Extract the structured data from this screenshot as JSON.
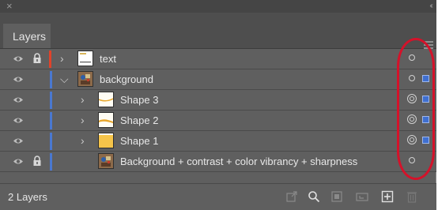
{
  "titlebar": {
    "close_glyph": "×",
    "collapse_glyph": "‹‹"
  },
  "panel": {
    "tab_label": "Layers"
  },
  "layers": [
    {
      "name": "text",
      "visible": true,
      "locked": true,
      "color": "#e0432a",
      "expandable": true,
      "expanded": false,
      "indent": 0,
      "thumb": "text-thumb",
      "target": "single",
      "selected": false
    },
    {
      "name": "background",
      "visible": true,
      "locked": false,
      "color": "#4a78d0",
      "expandable": true,
      "expanded": true,
      "indent": 0,
      "thumb": "photo-thumb",
      "target": "single",
      "selected": true
    },
    {
      "name": "Shape 3",
      "visible": true,
      "locked": false,
      "color": "#4a78d0",
      "expandable": true,
      "expanded": false,
      "indent": 1,
      "thumb": "shape-thumb",
      "target": "double",
      "selected": true
    },
    {
      "name": "Shape 2",
      "visible": true,
      "locked": false,
      "color": "#4a78d0",
      "expandable": true,
      "expanded": false,
      "indent": 1,
      "thumb": "shape-thumb",
      "target": "double",
      "selected": true
    },
    {
      "name": "Shape 1",
      "visible": true,
      "locked": false,
      "color": "#4a78d0",
      "expandable": true,
      "expanded": false,
      "indent": 1,
      "thumb": "shape-thumb",
      "target": "double",
      "selected": true
    },
    {
      "name": "Background + contrast + color vibrancy + sharpness",
      "visible": true,
      "locked": true,
      "color": "#4a78d0",
      "expandable": false,
      "expanded": false,
      "indent": 1,
      "thumb": "photo-thumb",
      "target": "single",
      "selected": false
    }
  ],
  "footer": {
    "count_label": "2 Layers",
    "icons": [
      "export-icon",
      "search-icon",
      "clipping-mask-icon",
      "sublayer-icon",
      "new-layer-icon",
      "trash-icon"
    ]
  },
  "colors": {
    "panel_bg": "#5f5f5f",
    "annotation_red": "#d4122a",
    "selection_blue": "#3f6fd0"
  }
}
